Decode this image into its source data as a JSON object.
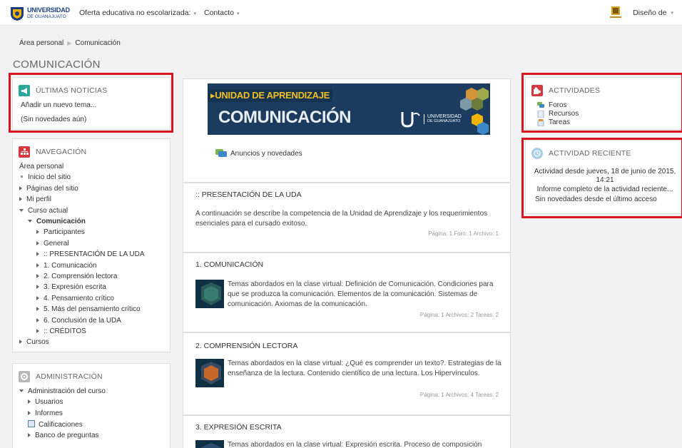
{
  "navbar": {
    "logo_line1": "UNIVERSIDAD",
    "logo_line2": "DE GUANAJUATO",
    "menu_items": [
      {
        "label": "Oferta educativa no escolarizada:"
      },
      {
        "label": "Contacto"
      }
    ],
    "caret": "▾",
    "user_label": "Diseño de",
    "crest_text": "UNIVERSIDAD DE GUANAJUATO"
  },
  "breadcrumb": {
    "items": [
      "Área personal",
      "Comunicación"
    ],
    "separator": "▶"
  },
  "page_title": "COMUNICACIÓN",
  "news": {
    "title": "ÚLTIMAS NOTICIAS",
    "add_link": "Añadir un nuevo tema...",
    "empty": "(Sin novedades aún)"
  },
  "navigation": {
    "title": "NAVEGACIÓN",
    "items": [
      {
        "label": "Área personal",
        "kind": "none"
      },
      {
        "label": "Inicio del sitio",
        "kind": "bullet"
      },
      {
        "label": "Páginas del sitio",
        "kind": "right"
      },
      {
        "label": "Mi perfil",
        "kind": "right"
      },
      {
        "label": "Curso actual",
        "kind": "down"
      },
      {
        "label": "Comunicación",
        "kind": "down"
      },
      {
        "label": "Participantes",
        "kind": "right"
      },
      {
        "label": "General",
        "kind": "right"
      },
      {
        "label": ":: PRESENTACIÓN DE LA UDA",
        "kind": "right"
      },
      {
        "label": "1. Comunicación",
        "kind": "right"
      },
      {
        "label": "2. Comprensión lectora",
        "kind": "right"
      },
      {
        "label": "3. Expresión escrita",
        "kind": "right"
      },
      {
        "label": "4. Pensamiento crítico",
        "kind": "right"
      },
      {
        "label": "5. Más del pensamiento crítico",
        "kind": "right"
      },
      {
        "label": "6. Conclusión de la UDA",
        "kind": "right"
      },
      {
        "label": ":: CRÉDITOS",
        "kind": "right"
      },
      {
        "label": "Cursos",
        "kind": "right"
      }
    ]
  },
  "administration": {
    "title": "ADMINISTRACIÓN",
    "items": [
      {
        "label": "Administración del curso",
        "kind": "down"
      },
      {
        "label": "Usuarios",
        "kind": "right"
      },
      {
        "label": "Informes",
        "kind": "right"
      },
      {
        "label": "Calificaciones",
        "kind": "icon"
      },
      {
        "label": "Banco de preguntas",
        "kind": "right"
      }
    ]
  },
  "banner": {
    "tag": "UNIDAD DE APRENDIZAJE",
    "title": "COMUNICACIÓN",
    "ug_line1": "UNIVERSIDAD",
    "ug_line2": "DE GUANAJUATO"
  },
  "announcements_link": "Anuncios y novedades",
  "sections": [
    {
      "title": ":: PRESENTACIÓN DE LA UDA",
      "desc": "A continuación se describe la competencia de la Unidad de Aprendizaje y los requerimientos esenciales para el cursado exitoso.",
      "meta": "Página: 1  Foro: 1  Archivo: 1"
    },
    {
      "title": "1. COMUNICACIÓN",
      "desc": "Temas abordados en la clase virtual: Definición de Comunicación. Condiciones para que se produzca la comunicación. Elementos de la comunicación. Sistemas de comunicación. Axiomas de la comunicación.",
      "meta": "Página: 1  Archivos: 2  Tareas: 2"
    },
    {
      "title": "2. COMPRENSIÓN LECTORA",
      "desc": "Temas abordados en la clase virtual: ¿Qué es comprender un texto?. Estrategias de la enseñanza de la lectura. Contenido científico de una lectura. Los Hipervínculos.",
      "meta": "Página: 1  Archivos: 4  Tareas: 2"
    },
    {
      "title": "3. EXPRESIÓN ESCRITA",
      "desc": "Temas abordados en la clase virtual: Expresión escrita. Proceso de composición",
      "meta": ""
    }
  ],
  "activities": {
    "title": "ACTIVIDADES",
    "items": [
      {
        "label": "Foros",
        "icon": "forum-icon"
      },
      {
        "label": "Recursos",
        "icon": "resource-icon"
      },
      {
        "label": "Tareas",
        "icon": "assignment-icon"
      }
    ]
  },
  "recent": {
    "title": "ACTIVIDAD RECIENTE",
    "since_line1": "Actividad desde jueves, 18 de junio de 2015,",
    "since_line2": "14:21",
    "full_report": "Informe completo de la actividad reciente...",
    "no_news": "Sin novedades desde el último acceso"
  },
  "colors": {
    "accent_red": "#d8141e",
    "news_icon": "#2aa89a",
    "nav_icon": "#d7373f",
    "admin_icon": "#b8b8b8",
    "activities_icon": "#d7373f",
    "recent_icon": "#a8cde6",
    "banner_bg": "#1b3c5e",
    "banner_tag": "#f0c020"
  }
}
